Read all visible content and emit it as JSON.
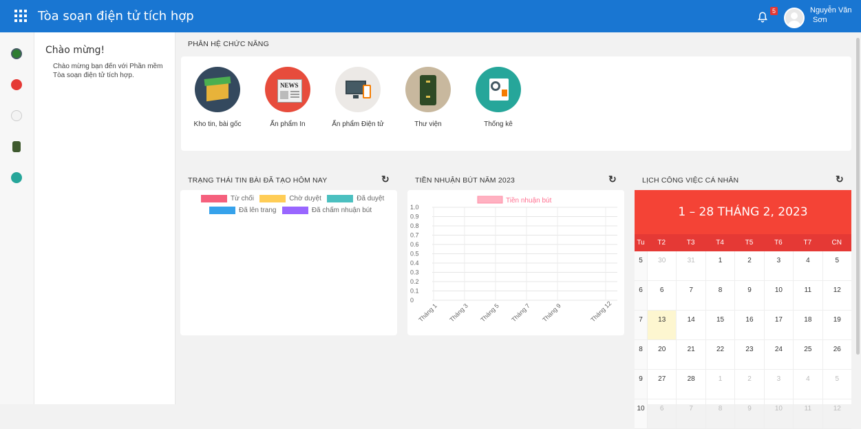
{
  "app": {
    "title": "Tòa soạn điện tử tích hợp",
    "user_first": "Nguyễn Văn",
    "user_last": "Sơn",
    "notification_count": "5",
    "menu_icon": "grid-menu-icon",
    "bell_icon": "bell-icon"
  },
  "colors": {
    "primary": "#1976d2",
    "calendar_head": "#f44336",
    "calendar_dow": "#e53935"
  },
  "welcome": {
    "title": "Chào mừng!",
    "text": "Chào mừng bạn đến với Phần mềm Tòa soạn điện tử tích hợp."
  },
  "sections": {
    "modules_title": "PHÂN HỆ CHỨC NĂNG",
    "status_title": "TRẠNG THÁI TIN BÀI ĐÃ TẠO HÔM NAY",
    "royalty_title": "TIỀN NHUẬN BÚT NĂM 2023",
    "calendar_title": "LỊCH CÔNG VIỆC CÁ NHÂN"
  },
  "modules": [
    {
      "label": "Kho tin, bài gốc",
      "icon": "box-icon"
    },
    {
      "label": "Ấn phẩm In",
      "icon": "newspaper-icon"
    },
    {
      "label": "Ấn phẩm Điện tử",
      "icon": "devices-icon"
    },
    {
      "label": "Thư viện",
      "icon": "file-cabinet-icon"
    },
    {
      "label": "Thống kê",
      "icon": "statistics-icon"
    }
  ],
  "status_legend": [
    {
      "label": "Từ chối",
      "color": "#f5607d"
    },
    {
      "label": "Chờ duyệt",
      "color": "#ffcd56"
    },
    {
      "label": "Đã duyệt",
      "color": "#4bc0c0"
    },
    {
      "label": "Đã lên trang",
      "color": "#36a2eb"
    },
    {
      "label": "Đã chấm nhuận bút",
      "color": "#9966ff"
    }
  ],
  "chart_data": {
    "type": "line",
    "legend": [
      {
        "name": "Tiền nhuận bút",
        "color": "#ffb1c1"
      }
    ],
    "y_ticks": [
      "1.0",
      "0.9",
      "0.8",
      "0.7",
      "0.6",
      "0.5",
      "0.4",
      "0.3",
      "0.2",
      "0.1",
      "0"
    ],
    "x_ticks": [
      "Tháng 1",
      "Tháng 3",
      "Tháng 5",
      "Tháng 7",
      "Tháng 9",
      "Tháng 12"
    ],
    "ylim": [
      0,
      1
    ],
    "grid": true,
    "series": []
  },
  "calendar": {
    "title": "1 – 28 THÁNG 2, 2023",
    "dows": [
      "Tu",
      "T2",
      "T3",
      "T4",
      "T5",
      "T6",
      "T7",
      "CN"
    ],
    "weeks": [
      {
        "wk": "5",
        "days": [
          "30",
          "31",
          "1",
          "2",
          "3",
          "4",
          "5"
        ]
      },
      {
        "wk": "6",
        "days": [
          "6",
          "7",
          "8",
          "9",
          "10",
          "11",
          "12"
        ]
      },
      {
        "wk": "7",
        "days": [
          "13",
          "14",
          "15",
          "16",
          "17",
          "18",
          "19"
        ]
      },
      {
        "wk": "8",
        "days": [
          "20",
          "21",
          "22",
          "23",
          "24",
          "25",
          "26"
        ]
      },
      {
        "wk": "9",
        "days": [
          "27",
          "28",
          "1",
          "2",
          "3",
          "4",
          "5"
        ]
      },
      {
        "wk": "10",
        "days": [
          "6",
          "7",
          "8",
          "9",
          "10",
          "11",
          "12"
        ]
      }
    ]
  }
}
